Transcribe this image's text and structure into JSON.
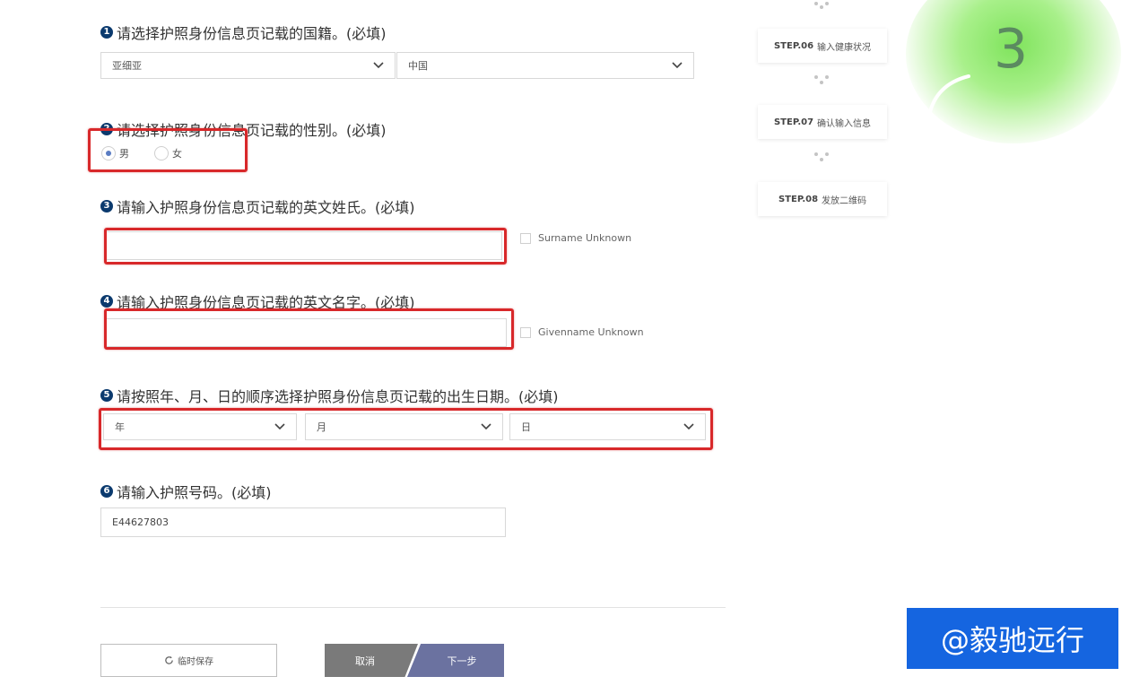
{
  "questions": {
    "q1": {
      "num": "1",
      "label": "请选择护照身份信息页记载的国籍。(必填)",
      "region": "亚细亚",
      "country": "中国"
    },
    "q2": {
      "num": "2",
      "label": "请选择护照身份信息页记载的性别。(必填)",
      "male": "男",
      "female": "女",
      "selected": "男"
    },
    "q3": {
      "num": "3",
      "label": "请输入护照身份信息页记载的英文姓氏。(必填)",
      "value": "",
      "unknown_label": "Surname Unknown"
    },
    "q4": {
      "num": "4",
      "label": "请输入护照身份信息页记载的英文名字。(必填)",
      "value": "",
      "unknown_label": "Givenname Unknown"
    },
    "q5": {
      "num": "5",
      "label": "请按照年、月、日的顺序选择护照身份信息页记载的出生日期。(必填)",
      "year": "年",
      "month": "月",
      "day": "日"
    },
    "q6": {
      "num": "6",
      "label": "请输入护照号码。(必填)",
      "value": "E44627803"
    }
  },
  "steps": [
    {
      "step": "STEP.06",
      "label": "输入健康状况"
    },
    {
      "step": "STEP.07",
      "label": "确认输入信息"
    },
    {
      "step": "STEP.08",
      "label": "发放二维码"
    }
  ],
  "buttons": {
    "save": "临时保存",
    "cancel": "取消",
    "next": "下一步"
  },
  "overlay": {
    "badge_number": "3",
    "watermark": "@毅驰远行"
  },
  "colors": {
    "highlight": "#d8282a",
    "number_badge": "#0b3a6e",
    "next_button": "#6b72a0",
    "cancel_button": "#7a7a7a",
    "watermark_bg": "#1565e0",
    "badge_glow": "#7fe35c"
  }
}
